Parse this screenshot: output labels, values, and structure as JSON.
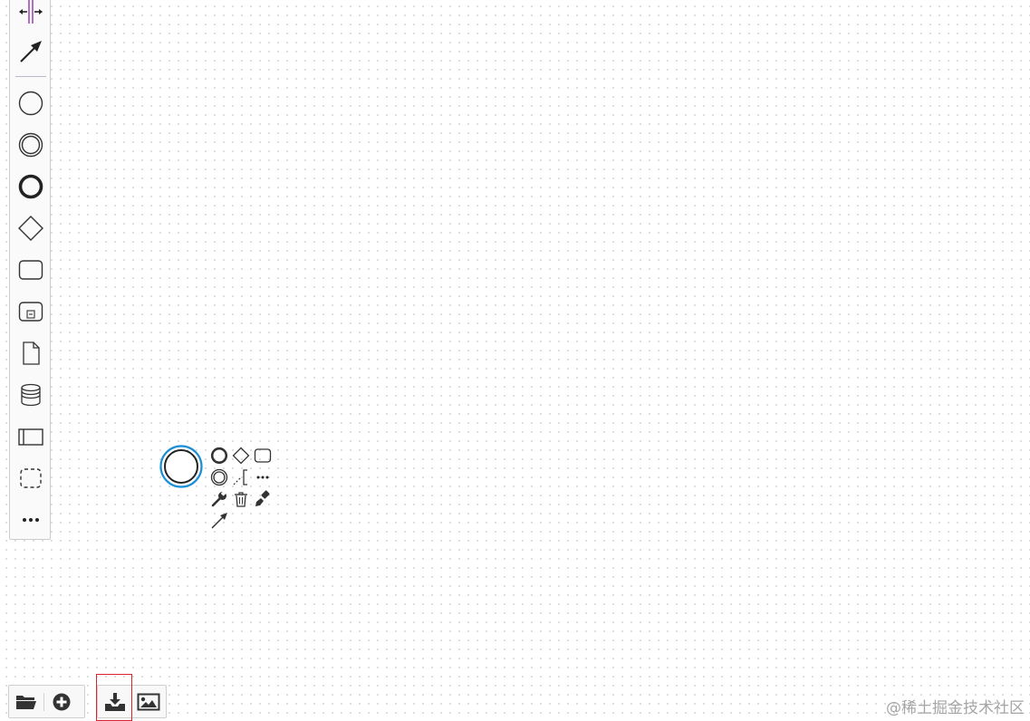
{
  "palette": {
    "tools": [
      {
        "id": "space-tool",
        "icon": "space-tool-icon"
      },
      {
        "id": "global-connect-tool",
        "icon": "connect-arrow-icon"
      },
      {
        "id": "create-start-event",
        "icon": "start-event-icon"
      },
      {
        "id": "create-intermediate-event",
        "icon": "intermediate-event-icon"
      },
      {
        "id": "create-end-event",
        "icon": "end-event-icon"
      },
      {
        "id": "create-gateway",
        "icon": "gateway-icon"
      },
      {
        "id": "create-task",
        "icon": "task-icon"
      },
      {
        "id": "create-subprocess",
        "icon": "subprocess-icon"
      },
      {
        "id": "create-data-object",
        "icon": "data-object-icon"
      },
      {
        "id": "create-data-store",
        "icon": "data-store-icon"
      },
      {
        "id": "create-pool",
        "icon": "pool-icon"
      },
      {
        "id": "create-group",
        "icon": "group-icon"
      },
      {
        "id": "more-tools",
        "icon": "ellipsis-icon"
      }
    ]
  },
  "context_pad": {
    "items": [
      {
        "id": "append-end-event",
        "icon": "end-event-icon"
      },
      {
        "id": "append-gateway",
        "icon": "gateway-icon"
      },
      {
        "id": "append-task",
        "icon": "task-icon"
      },
      {
        "id": "append-intermediate-event",
        "icon": "intermediate-event-icon"
      },
      {
        "id": "append-text-annotation",
        "icon": "text-annotation-icon"
      },
      {
        "id": "more-options",
        "icon": "ellipsis-icon"
      },
      {
        "id": "change-type",
        "icon": "wrench-icon"
      },
      {
        "id": "delete",
        "icon": "trash-icon"
      },
      {
        "id": "set-color",
        "icon": "paint-brush-icon"
      },
      {
        "id": "connect",
        "icon": "connect-arrow-icon"
      }
    ]
  },
  "toolbar": {
    "buttons": [
      {
        "id": "open-file",
        "icon": "folder-icon"
      },
      {
        "id": "create-new",
        "icon": "plus-circle-icon"
      },
      {
        "id": "download-xml",
        "icon": "download-icon"
      },
      {
        "id": "download-image",
        "icon": "image-icon"
      }
    ]
  },
  "watermark": {
    "text": "@稀土掘金技术社区"
  },
  "colors": {
    "selection": "#1a8fd8",
    "highlight": "#d9232f",
    "icon": "#333333"
  }
}
